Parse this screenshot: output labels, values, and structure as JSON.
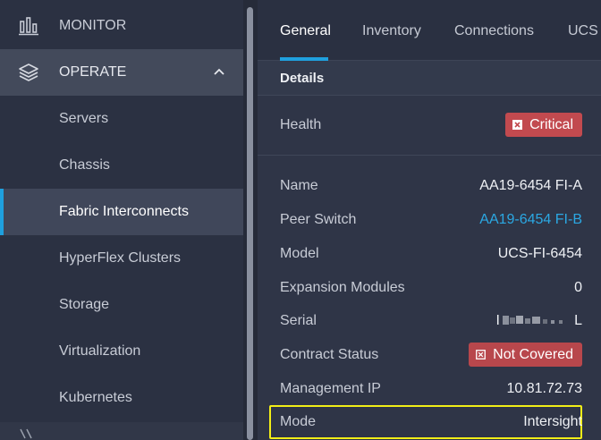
{
  "sidebar": {
    "monitor_label": "MONITOR",
    "operate_label": "OPERATE",
    "sub_items": [
      {
        "label": "Servers"
      },
      {
        "label": "Chassis"
      },
      {
        "label": "Fabric Interconnects"
      },
      {
        "label": "HyperFlex Clusters"
      },
      {
        "label": "Storage"
      },
      {
        "label": "Virtualization"
      },
      {
        "label": "Kubernetes"
      }
    ],
    "selected": "Fabric Interconnects"
  },
  "tabs": [
    {
      "label": "General"
    },
    {
      "label": "Inventory"
    },
    {
      "label": "Connections"
    },
    {
      "label": "UCS I"
    }
  ],
  "details": {
    "section_title": "Details",
    "health": {
      "label": "Health",
      "value": "Critical"
    },
    "rows": [
      {
        "label": "Name",
        "value": "AA19-6454 FI-A"
      },
      {
        "label": "Peer Switch",
        "value": "AA19-6454 FI-B"
      },
      {
        "label": "Model",
        "value": "UCS-FI-6454"
      },
      {
        "label": "Expansion Modules",
        "value": "0"
      },
      {
        "label": "Serial",
        "value_prefix": "I",
        "value_suffix": "L"
      },
      {
        "label": "Contract Status",
        "value": "Not Covered"
      },
      {
        "label": "Management IP",
        "value": "10.81.72.73"
      },
      {
        "label": "Mode",
        "value": "Intersight"
      }
    ]
  },
  "colors": {
    "accent": "#1fa0de",
    "link": "#2ba8e3",
    "critical": "#c24a4f",
    "highlight": "#f2ee17"
  }
}
